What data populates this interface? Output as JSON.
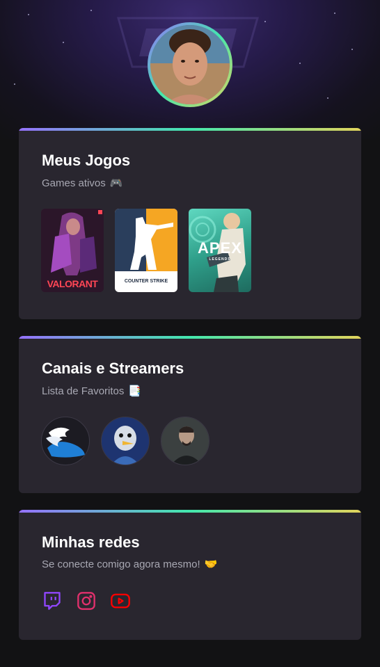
{
  "profile": {
    "avatar_label": "profile photo"
  },
  "games_card": {
    "title": "Meus Jogos",
    "subtitle": "Games ativos",
    "subtitle_emoji": "🎮",
    "games": [
      {
        "name": "VALORANT",
        "label": "VALORANT"
      },
      {
        "name": "Counter-Strike",
        "label_top": "COUNTER",
        "label_right": "STRIKE"
      },
      {
        "name": "Apex Legends",
        "label": "APEX",
        "sublabel": "LEGENDS"
      }
    ]
  },
  "streamers_card": {
    "title": "Canais e Streamers",
    "subtitle": "Lista de Favoritos",
    "subtitle_emoji": "📑",
    "streamers": [
      {
        "id": "streamer-1"
      },
      {
        "id": "streamer-2"
      },
      {
        "id": "streamer-3"
      }
    ]
  },
  "social_card": {
    "title": "Minhas redes",
    "subtitle": "Se conecte comigo agora mesmo!",
    "subtitle_emoji": "🤝",
    "links": [
      {
        "name": "twitch-icon",
        "color": "#9146ff"
      },
      {
        "name": "instagram-icon",
        "color": "#e1306c"
      },
      {
        "name": "youtube-icon",
        "color": "#ff0000"
      }
    ]
  },
  "colors": {
    "background": "#121214",
    "card": "#29262f",
    "accent_gradient": [
      "#9572fc",
      "#43e7ad",
      "#e2d45c"
    ],
    "subtitle": "#a8a8b3"
  }
}
